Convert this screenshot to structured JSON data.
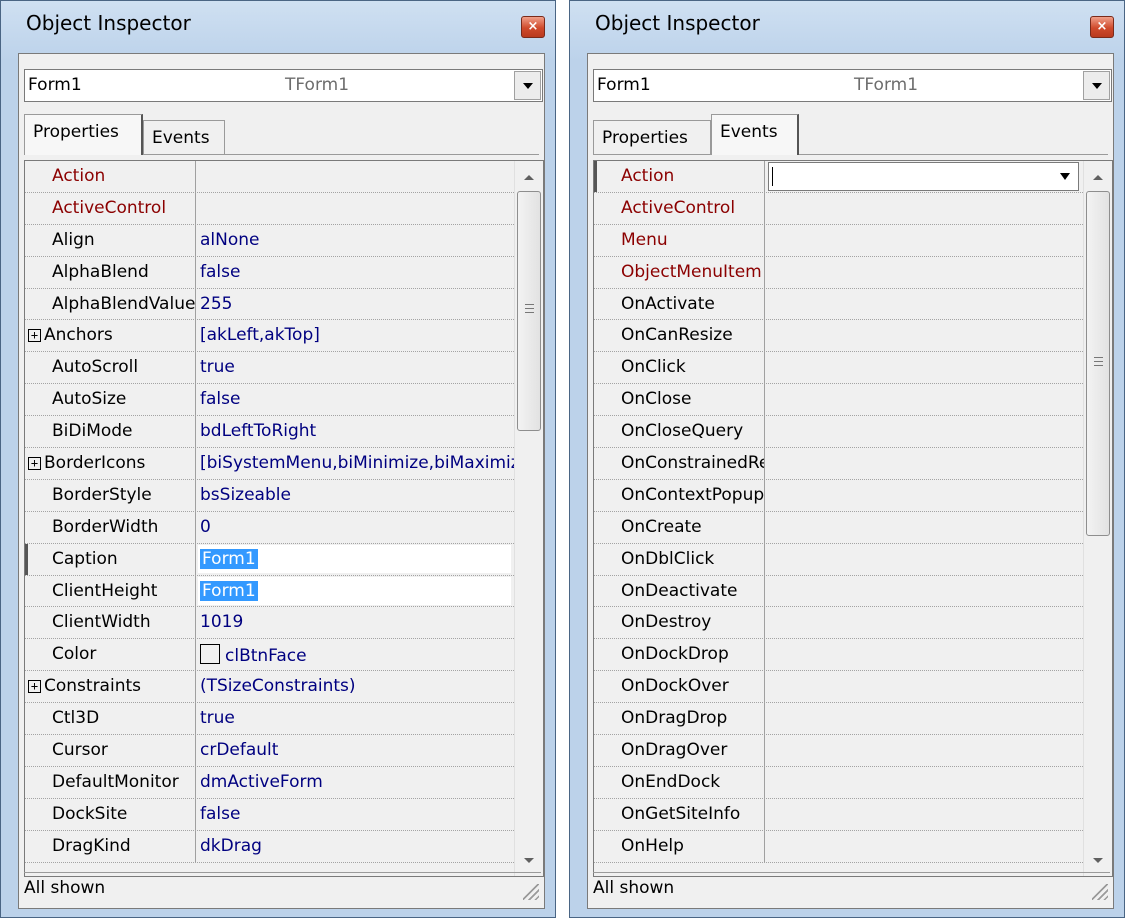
{
  "left": {
    "title": "Object Inspector",
    "close_glyph": "×",
    "component": {
      "name": "Form1",
      "class": "TForm1"
    },
    "tabs": [
      {
        "label": "Properties",
        "active": true
      },
      {
        "label": "Events",
        "active": false
      }
    ],
    "rows": [
      {
        "name": "Action",
        "value": "",
        "red": true
      },
      {
        "name": "ActiveControl",
        "value": "",
        "red": true
      },
      {
        "name": "Align",
        "value": "alNone"
      },
      {
        "name": "AlphaBlend",
        "value": "false"
      },
      {
        "name": "AlphaBlendValue",
        "value": "255"
      },
      {
        "name": "Anchors",
        "value": "[akLeft,akTop]",
        "expand": true
      },
      {
        "name": "AutoScroll",
        "value": "true"
      },
      {
        "name": "AutoSize",
        "value": "false"
      },
      {
        "name": "BiDiMode",
        "value": "bdLeftToRight"
      },
      {
        "name": "BorderIcons",
        "value": "[biSystemMenu,biMinimize,biMaximize]",
        "expand": true
      },
      {
        "name": "BorderStyle",
        "value": "bsSizeable"
      },
      {
        "name": "BorderWidth",
        "value": "0"
      },
      {
        "name": "Caption",
        "value": "Form1",
        "active": true,
        "selected": true
      },
      {
        "name": "ClientHeight",
        "value": "Form1",
        "selected": true
      },
      {
        "name": "ClientWidth",
        "value": "1019"
      },
      {
        "name": "Color",
        "value": "clBtnFace",
        "swatch": true
      },
      {
        "name": "Constraints",
        "value": "(TSizeConstraints)",
        "expand": true
      },
      {
        "name": "Ctl3D",
        "value": "true"
      },
      {
        "name": "Cursor",
        "value": "crDefault"
      },
      {
        "name": "DefaultMonitor",
        "value": "dmActiveForm"
      },
      {
        "name": "DockSite",
        "value": "false"
      },
      {
        "name": "DragKind",
        "value": "dkDrag"
      }
    ],
    "status": "All shown"
  },
  "right": {
    "title": "Object Inspector",
    "close_glyph": "×",
    "component": {
      "name": "Form1",
      "class": "TForm1"
    },
    "tabs": [
      {
        "label": "Properties",
        "active": false
      },
      {
        "label": "Events",
        "active": true
      }
    ],
    "rows": [
      {
        "name": "Action",
        "red": true,
        "active": true
      },
      {
        "name": "ActiveControl",
        "red": true
      },
      {
        "name": "Menu",
        "red": true
      },
      {
        "name": "ObjectMenuItem",
        "red": true
      },
      {
        "name": "OnActivate"
      },
      {
        "name": "OnCanResize"
      },
      {
        "name": "OnClick"
      },
      {
        "name": "OnClose"
      },
      {
        "name": "OnCloseQuery"
      },
      {
        "name": "OnConstrainedResize"
      },
      {
        "name": "OnContextPopup"
      },
      {
        "name": "OnCreate"
      },
      {
        "name": "OnDblClick"
      },
      {
        "name": "OnDeactivate"
      },
      {
        "name": "OnDestroy"
      },
      {
        "name": "OnDockDrop"
      },
      {
        "name": "OnDockOver"
      },
      {
        "name": "OnDragDrop"
      },
      {
        "name": "OnDragOver"
      },
      {
        "name": "OnEndDock"
      },
      {
        "name": "OnGetSiteInfo"
      },
      {
        "name": "OnHelp"
      }
    ],
    "status": "All shown"
  }
}
